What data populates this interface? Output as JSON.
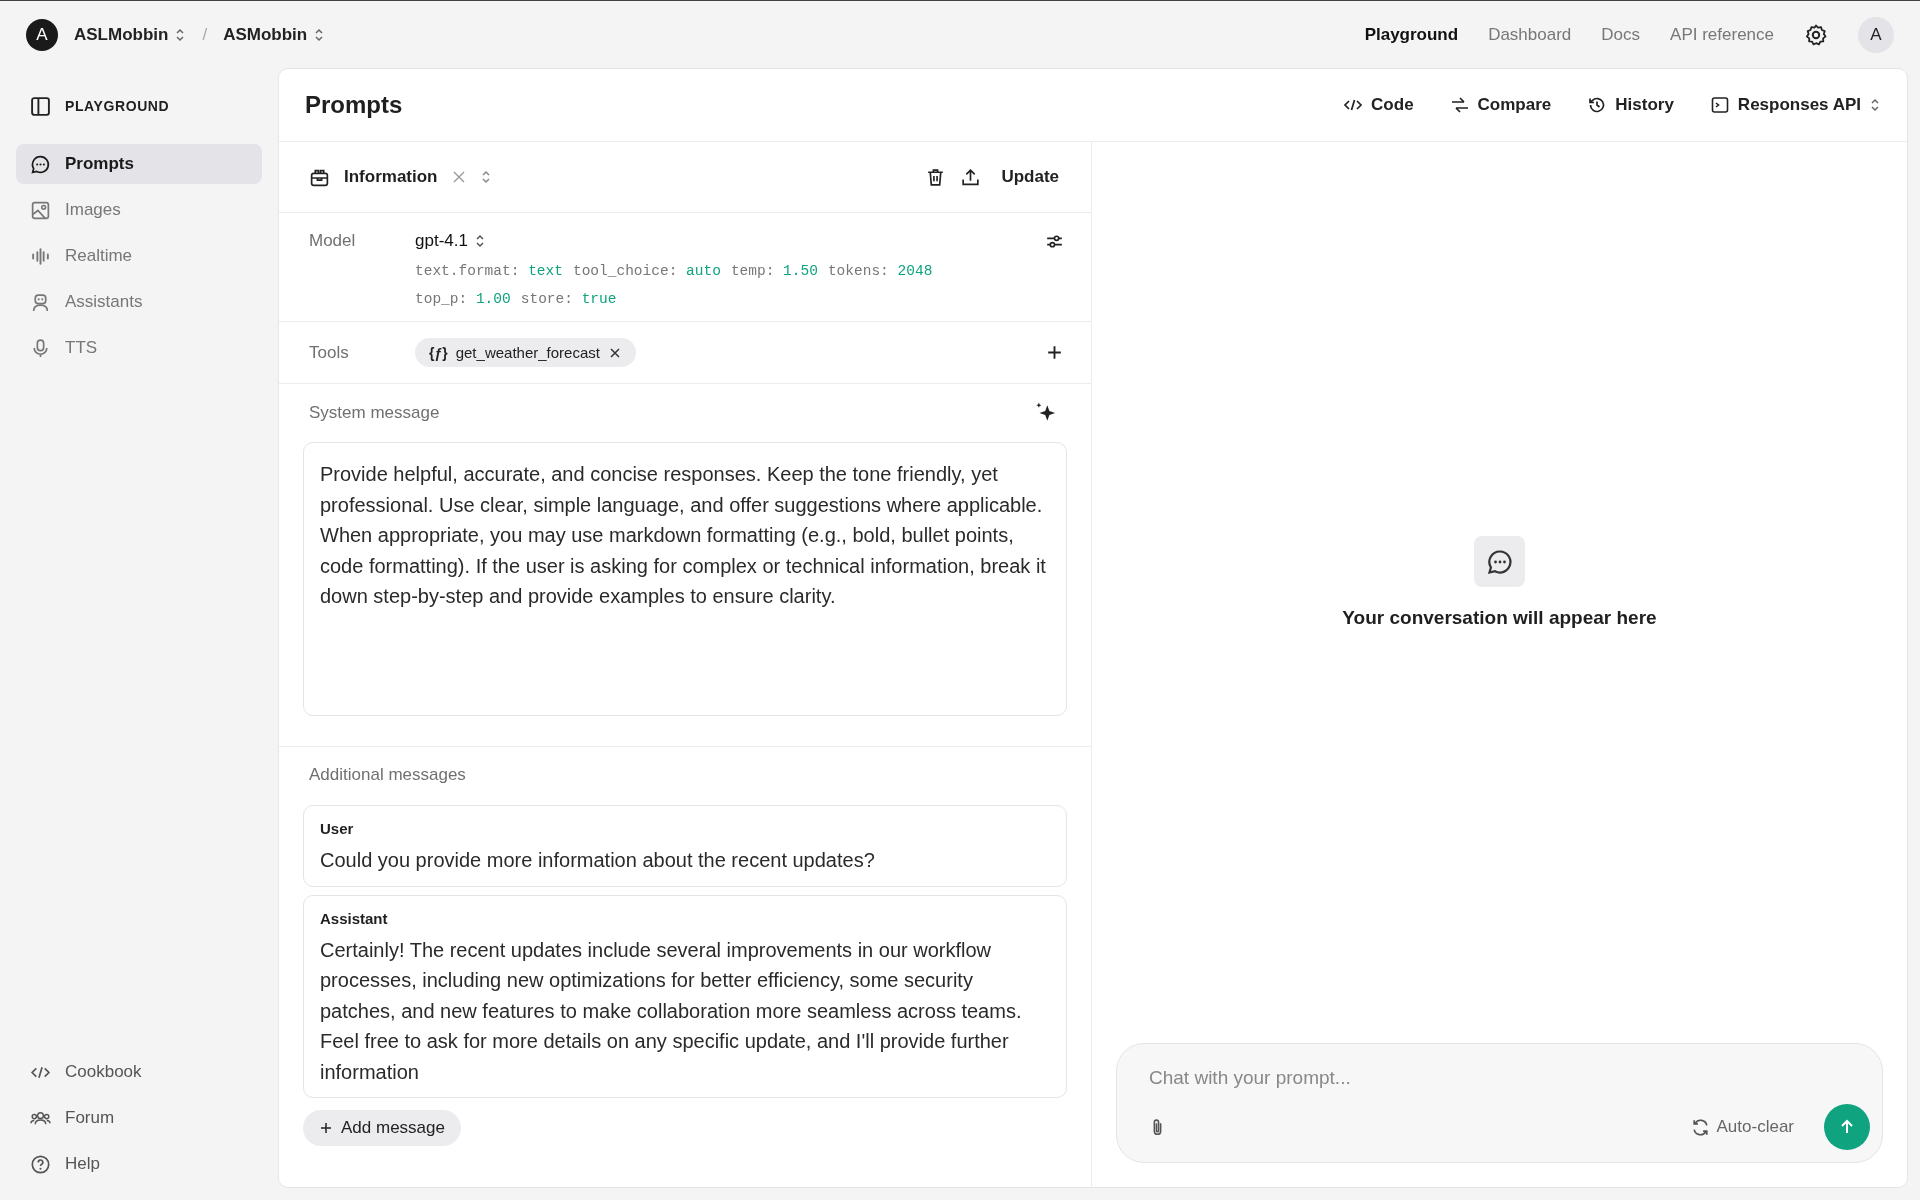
{
  "org": {
    "avatar": "A",
    "name": "ASLMobbin",
    "separator": "/",
    "project": "ASMobbin"
  },
  "top_nav": [
    {
      "label": "Playground",
      "selected": true
    },
    {
      "label": "Dashboard",
      "selected": false
    },
    {
      "label": "Docs",
      "selected": false
    },
    {
      "label": "API reference",
      "selected": false
    }
  ],
  "user_avatar": "A",
  "sidebar": {
    "title": "PLAYGROUND",
    "items": [
      {
        "label": "Prompts",
        "selected": true
      },
      {
        "label": "Images",
        "selected": false
      },
      {
        "label": "Realtime",
        "selected": false
      },
      {
        "label": "Assistants",
        "selected": false
      },
      {
        "label": "TTS",
        "selected": false
      }
    ],
    "footer_items": [
      {
        "label": "Cookbook"
      },
      {
        "label": "Forum"
      },
      {
        "label": "Help"
      }
    ]
  },
  "page": {
    "title": "Prompts",
    "actions": [
      {
        "label": "Code"
      },
      {
        "label": "Compare"
      },
      {
        "label": "History"
      },
      {
        "label": "Responses API"
      }
    ]
  },
  "prompt": {
    "name": "Information",
    "update": "Update",
    "model_label": "Model",
    "model": "gpt-4.1",
    "params": [
      [
        {
          "key": "text.format:",
          "value": "text"
        },
        {
          "key": "tool_choice:",
          "value": "auto"
        },
        {
          "key": "temp:",
          "value": "1.50"
        },
        {
          "key": "tokens:",
          "value": "2048"
        }
      ],
      [
        {
          "key": "top_p:",
          "value": "1.00"
        },
        {
          "key": "store:",
          "value": "true"
        }
      ]
    ],
    "tools_label": "Tools",
    "tools": [
      {
        "icon": "{ƒ}",
        "name": "get_weather_forecast"
      }
    ],
    "system_label": "System message",
    "system_message": "Provide helpful, accurate, and concise responses. Keep the tone friendly, yet professional. Use clear, simple language, and offer suggestions where applicable. When appropriate, you may use markdown formatting (e.g., bold, bullet points, code formatting). If the user is asking for complex or technical information, break it down step-by-step and provide examples to ensure clarity.",
    "additional_label": "Additional messages",
    "messages": [
      {
        "role": "User",
        "text": "Could you provide more information about the recent updates?"
      },
      {
        "role": "Assistant",
        "text": "Certainly! The recent updates include several improvements in our workflow processes, including new optimizations for better efficiency, some security patches, and new features to make collaboration more seamless across teams. Feel free to ask for more details on any specific update, and I'll provide further information"
      }
    ],
    "add_message": "Add message"
  },
  "chat": {
    "empty_text": "Your conversation will appear here",
    "placeholder": "Chat with your prompt...",
    "auto_clear": "Auto-clear"
  }
}
